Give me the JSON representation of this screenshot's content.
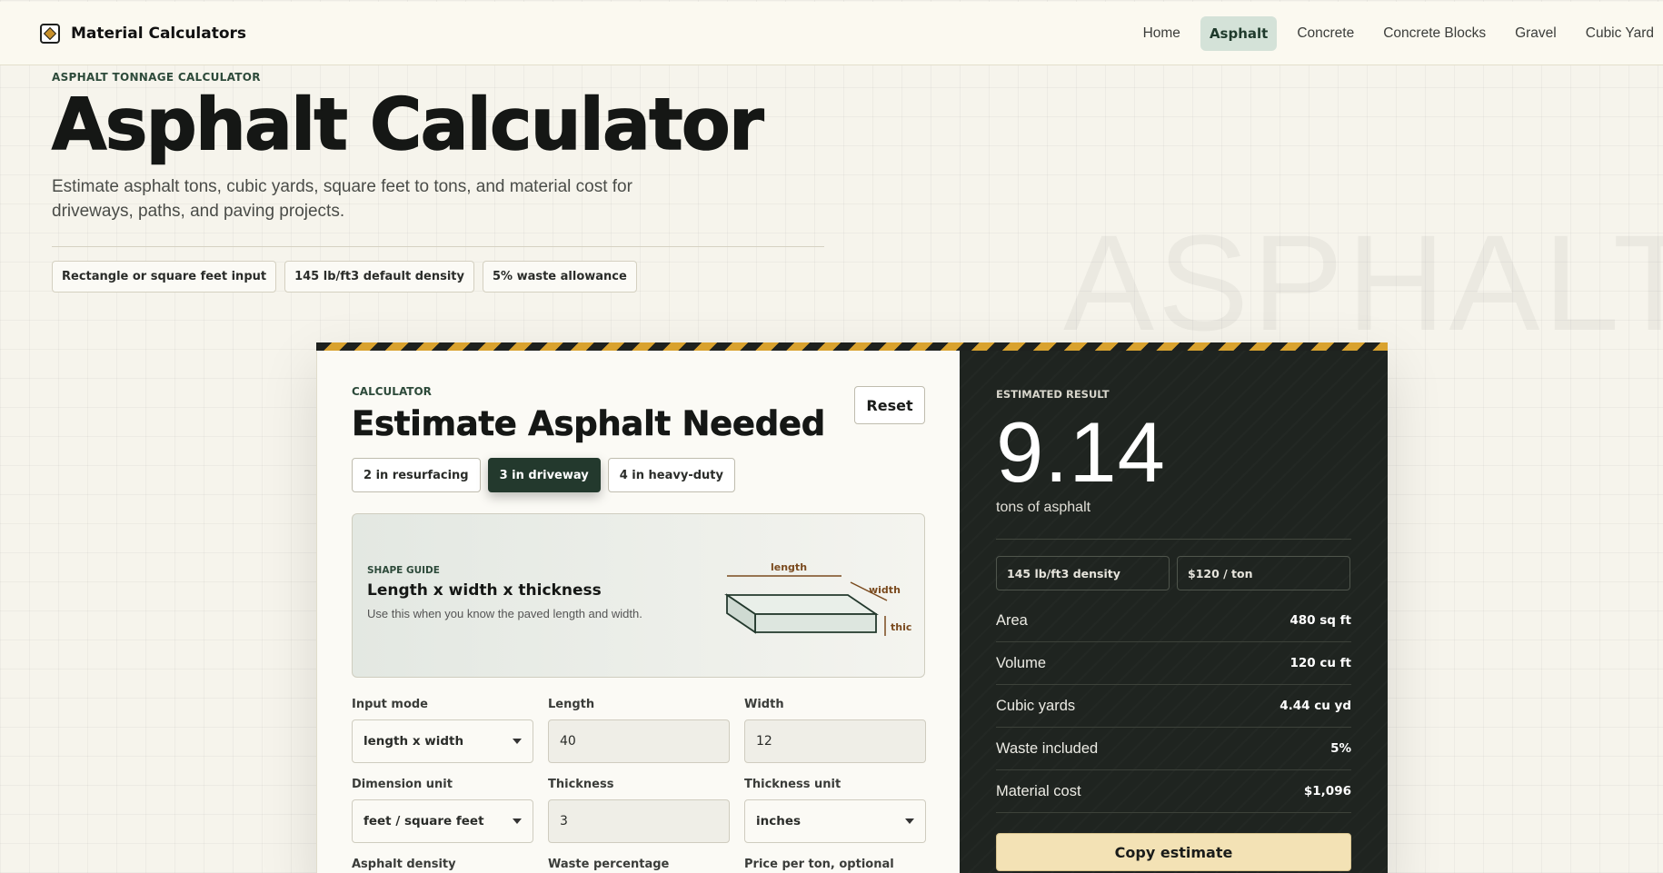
{
  "header": {
    "brand": "Material Calculators",
    "nav": [
      {
        "label": "Home",
        "active": false
      },
      {
        "label": "Asphalt",
        "active": true
      },
      {
        "label": "Concrete",
        "active": false
      },
      {
        "label": "Concrete Blocks",
        "active": false
      },
      {
        "label": "Gravel",
        "active": false
      },
      {
        "label": "Cubic Yard",
        "active": false
      }
    ]
  },
  "hero": {
    "eyebrow": "ASPHALT TONNAGE CALCULATOR",
    "title": "Asphalt Calculator",
    "subtitle": "Estimate asphalt tons, cubic yards, square feet to tons, and material cost for driveways, paths, and paving projects.",
    "chips": [
      "Rectangle or square feet input",
      "145 lb/ft3 default density",
      "5% waste allowance"
    ],
    "watermark": "ASPHALT"
  },
  "calculator": {
    "eyebrow": "CALCULATOR",
    "title": "Estimate Asphalt Needed",
    "reset_label": "Reset",
    "presets": [
      {
        "label": "2 in resurfacing",
        "active": false
      },
      {
        "label": "3 in driveway",
        "active": true
      },
      {
        "label": "4 in heavy-duty",
        "active": false
      }
    ],
    "guide": {
      "eyebrow": "SHAPE GUIDE",
      "title": "Length x width x thickness",
      "description": "Use this when you know the paved length and width.",
      "labels": {
        "length": "length",
        "width": "width",
        "thickness": "thick"
      }
    },
    "fields": {
      "input_mode": {
        "label": "Input mode",
        "value": "length x width"
      },
      "length": {
        "label": "Length",
        "value": "40"
      },
      "width": {
        "label": "Width",
        "value": "12"
      },
      "dimension_unit": {
        "label": "Dimension unit",
        "value": "feet / square feet"
      },
      "thickness": {
        "label": "Thickness",
        "value": "3"
      },
      "thickness_unit": {
        "label": "Thickness unit",
        "value": "inches"
      },
      "asphalt_density": {
        "label": "Asphalt density"
      },
      "waste_percentage": {
        "label": "Waste percentage"
      },
      "price_per_ton": {
        "label": "Price per ton, optional"
      }
    }
  },
  "result": {
    "eyebrow": "ESTIMATED RESULT",
    "value": "9.14",
    "unit": "tons of asphalt",
    "chips": [
      "145 lb/ft3 density",
      "$120 / ton"
    ],
    "rows": [
      {
        "label": "Area",
        "value": "480 sq ft"
      },
      {
        "label": "Volume",
        "value": "120 cu ft"
      },
      {
        "label": "Cubic yards",
        "value": "4.44 cu yd"
      },
      {
        "label": "Waste included",
        "value": "5%"
      },
      {
        "label": "Material cost",
        "value": "$1,096"
      }
    ],
    "copy_label": "Copy estimate"
  },
  "colors": {
    "accent_green": "#23392d",
    "hazard_yellow": "#d9a22e",
    "result_panel": "#1f2420",
    "copy_button": "#f3e2b5"
  }
}
